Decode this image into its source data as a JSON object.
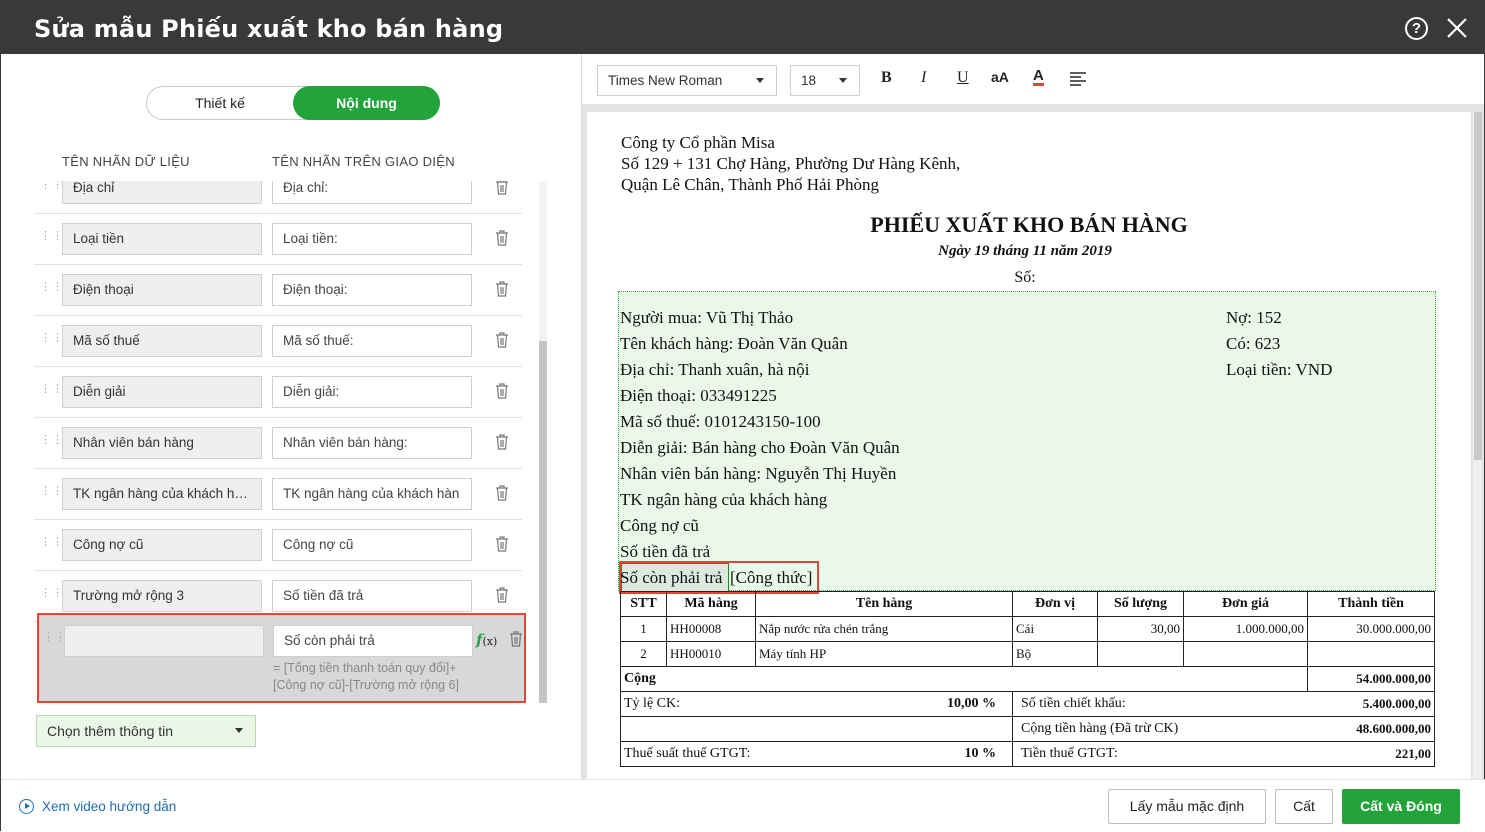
{
  "dialog": {
    "title": "Sửa mẫu Phiếu xuất kho bán hàng"
  },
  "tabs": {
    "design": "Thiết kế",
    "content": "Nội dung"
  },
  "columns": {
    "data_label": "TÊN NHÃN DỮ LIỆU",
    "ui_label": "TÊN NHÃN TRÊN GIAO DIỆN"
  },
  "rows": [
    {
      "data": "Địa chỉ",
      "ui": "Địa chỉ:"
    },
    {
      "data": "Loại tiền",
      "ui": "Loại tiền:"
    },
    {
      "data": "Điện thoại",
      "ui": "Điện thoại:"
    },
    {
      "data": "Mã số thuế",
      "ui": "Mã số thuế:"
    },
    {
      "data": "Diễn giải",
      "ui": "Diễn giải:"
    },
    {
      "data": "Nhân viên bán hàng",
      "ui": "Nhân viên bán hàng:"
    },
    {
      "data": "TK ngân hàng của khách hà...",
      "ui": "TK ngân hàng của khách hàn"
    },
    {
      "data": "Công nợ cũ",
      "ui": "Công nợ cũ"
    },
    {
      "data": "Trường mở rộng 3",
      "ui": "Số tiền đã trả"
    }
  ],
  "selected_row": {
    "data": "",
    "ui": "Số còn phải trả",
    "fx_label": "f",
    "fx_arg": "(x)",
    "formula_line1": "= [Tổng tiền thanh toán quy đổi]+",
    "formula_line2": "[Công nợ cũ]-[Trường mở rộng 6]"
  },
  "add_info": "Chọn thêm thông tin",
  "toolbar": {
    "font": "Times New Roman",
    "size": "18",
    "bold": "B",
    "italic": "I",
    "underline": "U",
    "case": "aA",
    "color": "A"
  },
  "doc": {
    "company": "Công ty Cổ phần Misa",
    "address1": "Số 129 + 131 Chợ Hàng, Phường Dư Hàng Kênh,",
    "address2": "Quận Lê Chân, Thành Phố Hải Phòng",
    "title": "PHIẾU XUẤT KHO BÁN HÀNG",
    "date": "Ngày 19 tháng 11 năm 2019",
    "number": "Số:",
    "lines": [
      "Người mua: Vũ Thị Thảo",
      "Tên khách hàng: Đoàn Văn Quân",
      "Địa chỉ: Thanh xuân, hà nội",
      "Điện thoại: 033491225",
      "Mã số thuế: 0101243150-100",
      "Diễn giải: Bán hàng cho Đoàn Văn Quân",
      "Nhân viên bán hàng: Nguyễn Thị Huyền",
      "TK ngân hàng của khách hàng",
      "Công nợ cũ",
      "Số tiền đã trả"
    ],
    "right_lines": [
      "Nợ: 152",
      "Có: 623",
      "Loại tiền: VND"
    ],
    "remaining_label": "Số còn phải trả",
    "remaining_formula": "[Công thức]",
    "table_headers": [
      "STT",
      "Mã hàng",
      "Tên hàng",
      "Đơn vị",
      "Số lượng",
      "Đơn giá",
      "Thành tiền"
    ],
    "table_rows": [
      [
        "1",
        "HH00008",
        "Nắp nước rửa chén trắng",
        "Cái",
        "30,00",
        "1.000.000,00",
        "30.000.000,00"
      ],
      [
        "2",
        "HH00010",
        "Máy tính HP",
        "Bộ",
        "",
        "",
        ""
      ]
    ],
    "total_label": "Cộng",
    "total_value": "54.000.000,00",
    "discount_rate_label": "Tỷ lệ CK:",
    "discount_rate_value": "10,00 %",
    "discount_amount_label": "Số tiền chiết khấu:",
    "discount_amount_value": "5.400.000,00",
    "net_label": "Cộng tiền hàng (Đã trừ CK)",
    "net_value": "48.600.000,00",
    "vat_rate_label": "Thuế suất thuế GTGT:",
    "vat_rate_value": "10 %",
    "vat_amount_label": "Tiền thuế GTGT:",
    "vat_amount_value": "221,00"
  },
  "footer": {
    "video": "Xem video hướng dẫn",
    "default": "Lấy mẫu mặc định",
    "save": "Cất",
    "save_close": "Cất và Đóng"
  },
  "colors": {
    "accent": "#22a43a",
    "highlight": "#e0473a",
    "titlebar": "#38393b",
    "link": "#1f6cb3"
  }
}
